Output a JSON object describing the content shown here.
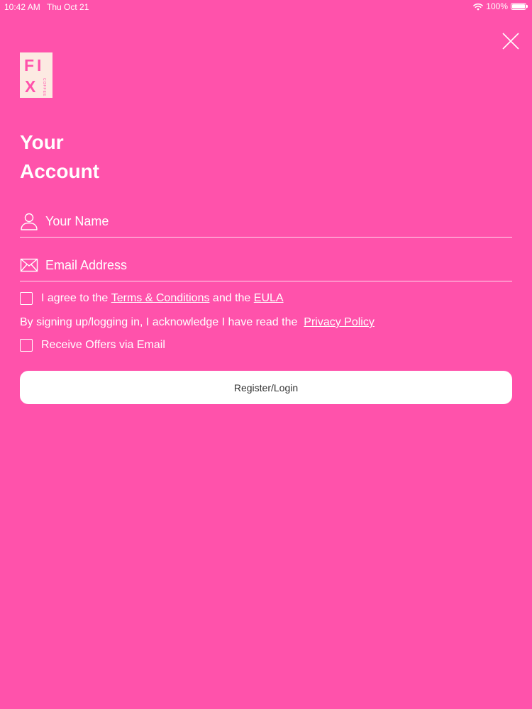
{
  "status_bar": {
    "time": "10:42 AM",
    "date": "Thu Oct 21",
    "battery": "100%",
    "battery_level": 1.0,
    "wifi_icon": "wifi-icon",
    "battery_icon": "battery-icon"
  },
  "close_icon": "close-icon",
  "logo": {
    "letters": "FIX",
    "subtext": "COFFEE",
    "color": "#FF52AB",
    "background": "#FCEAE2"
  },
  "heading": {
    "line1": "Your",
    "line2": "Account"
  },
  "form": {
    "name": {
      "placeholder": "Your Name",
      "value": "",
      "icon": "person-icon"
    },
    "email": {
      "placeholder": "Email Address",
      "value": "",
      "icon": "envelope-icon"
    },
    "terms": {
      "prefix": "I agree to the ",
      "terms_link": "Terms & Conditions",
      "middle": " and the ",
      "eula_link": "EULA"
    },
    "acknowledge": {
      "text": "By signing up/logging in, I acknowledge I have read the ",
      "privacy_link": "Privacy Policy"
    },
    "offers": {
      "label": "Receive Offers via Email"
    },
    "submit_label": "Register/Login"
  },
  "colors": {
    "background": "#FF52AB",
    "text": "#FFFFFF",
    "button_background": "#FFFFFF",
    "button_text": "#333333"
  }
}
